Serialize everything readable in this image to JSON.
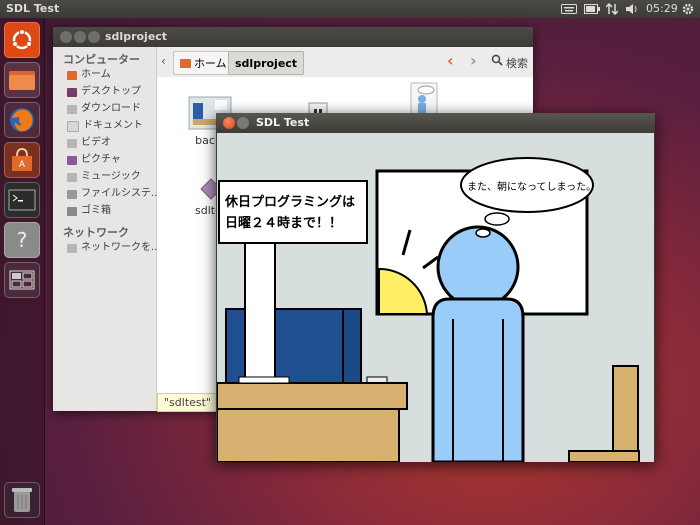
{
  "top_panel": {
    "app_title": "SDL Test",
    "clock": "05:29",
    "indicators": [
      "keyboard-icon",
      "battery-icon",
      "network-icon",
      "volume-icon",
      "gear-icon"
    ]
  },
  "launcher": {
    "items": [
      "ubuntu-logo-icon",
      "home-folder-icon",
      "firefox-icon",
      "software-center-icon",
      "terminal-icon",
      "help-icon",
      "workspace-switcher-icon",
      "trash-icon"
    ]
  },
  "file_manager": {
    "title": "sdlproject",
    "breadcrumb": {
      "home": "ホーム",
      "current": "sdlproject"
    },
    "search_label": "検索",
    "sidebar": {
      "computer_header": "コンピューター",
      "computer_items": [
        "ホーム",
        "デスクトップ",
        "ダウンロード",
        "ドキュメント",
        "ビデオ",
        "ピクチャ",
        "ミュージック",
        "ファイルシステ...",
        "ゴミ箱"
      ],
      "network_header": "ネットワーク",
      "network_items": [
        "ネットワークを..."
      ]
    },
    "files": [
      {
        "name": "back.",
        "icon": "image-file-icon"
      },
      {
        "name": "",
        "icon": "audio-file-icon"
      },
      {
        "name": "",
        "icon": "person-image-icon"
      },
      {
        "name": "sdlte",
        "icon": "executable-icon"
      }
    ],
    "status_text": "\"sdltest\" を"
  },
  "sdl_window": {
    "title": "SDL Test",
    "sign_text_line1": "休日プログラミングは",
    "sign_text_line2": "日曜２４時まで！！",
    "speech_bubble": "また、朝になってしまった。"
  }
}
